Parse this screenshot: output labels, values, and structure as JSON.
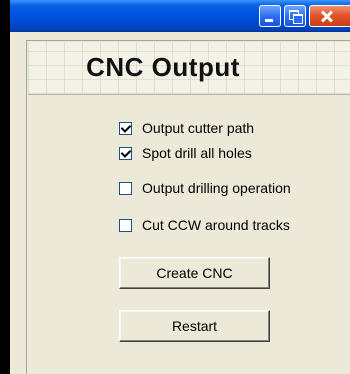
{
  "window": {
    "controls": [
      "minimize-icon",
      "maximize-icon",
      "close-icon"
    ]
  },
  "banner": {
    "title": "CNC Output"
  },
  "options": [
    {
      "label": "Output cutter path",
      "checked": true
    },
    {
      "label": "Spot drill all holes",
      "checked": true
    },
    {
      "label": "Output drilling operation",
      "checked": false
    },
    {
      "label": "Cut CCW around tracks",
      "checked": false
    }
  ],
  "buttons": {
    "create_label": "Create CNC",
    "restart_label": "Restart"
  },
  "colors": {
    "titlebar": "#0054e3",
    "close_button": "#e0522a",
    "dialog_face": "#ece9d8"
  }
}
